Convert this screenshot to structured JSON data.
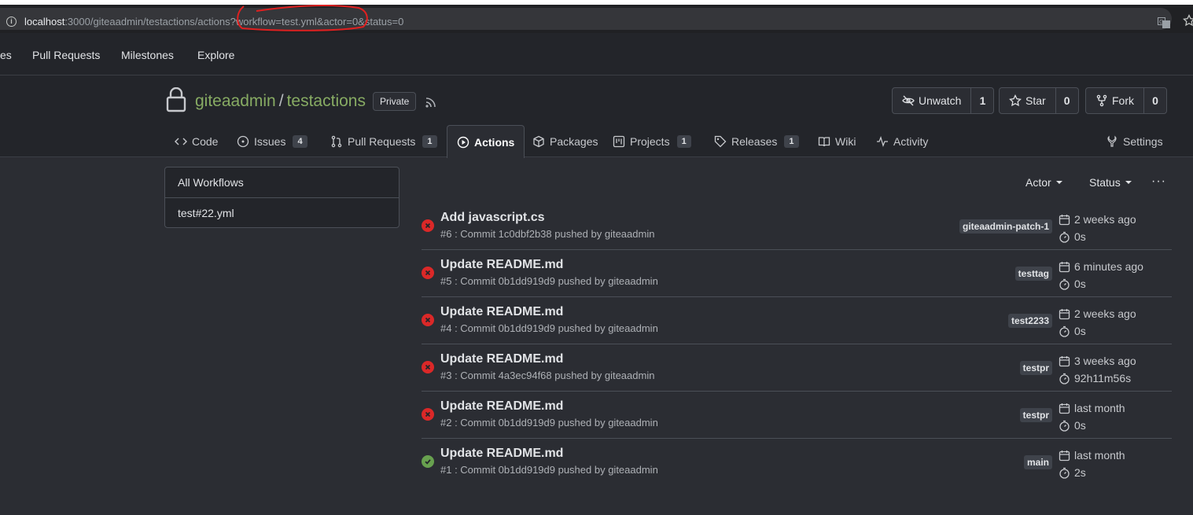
{
  "browser": {
    "url_host": "localhost",
    "url_rest": ":3000/giteaadmin/testactions/actions?workflow=test.yml&actor=0&status=0"
  },
  "topnav": {
    "items": [
      "es",
      "Pull Requests",
      "Milestones",
      "Explore"
    ]
  },
  "repo": {
    "owner": "giteaadmin",
    "separator": "/",
    "name": "testactions",
    "visibility": "Private",
    "unwatch_label": "Unwatch",
    "watch_count": "1",
    "star_label": "Star",
    "star_count": "0",
    "fork_label": "Fork",
    "fork_count": "0"
  },
  "tabs": [
    {
      "label": "Code",
      "icon": "code-icon"
    },
    {
      "label": "Issues",
      "icon": "issue-icon",
      "count": "4"
    },
    {
      "label": "Pull Requests",
      "icon": "pull-request-icon",
      "count": "1"
    },
    {
      "label": "Actions",
      "icon": "play-icon",
      "active": true
    },
    {
      "label": "Packages",
      "icon": "package-icon"
    },
    {
      "label": "Projects",
      "icon": "project-icon",
      "count": "1"
    },
    {
      "label": "Releases",
      "icon": "tag-icon",
      "count": "1"
    },
    {
      "label": "Wiki",
      "icon": "book-icon"
    },
    {
      "label": "Activity",
      "icon": "pulse-icon"
    },
    {
      "label": "Settings",
      "icon": "tool-icon"
    }
  ],
  "sidebar": {
    "items": [
      {
        "label": "All Workflows"
      },
      {
        "label": "test#22.yml"
      }
    ]
  },
  "filters": {
    "actor_label": "Actor",
    "status_label": "Status",
    "more_label": "···"
  },
  "runs": [
    {
      "title": "Add javascript.cs",
      "subtitle": "#6 : Commit 1c0dbf2b38 pushed by giteaadmin",
      "branch": "giteaadmin-patch-1",
      "time": "2 weeks ago",
      "duration": "0s",
      "status": "failure"
    },
    {
      "title": "Update README.md",
      "subtitle": "#5 : Commit 0b1dd919d9 pushed by giteaadmin",
      "branch": "testtag",
      "time": "6 minutes ago",
      "duration": "0s",
      "status": "failure"
    },
    {
      "title": "Update README.md",
      "subtitle": "#4 : Commit 0b1dd919d9 pushed by giteaadmin",
      "branch": "test2233",
      "time": "2 weeks ago",
      "duration": "0s",
      "status": "failure"
    },
    {
      "title": "Update README.md",
      "subtitle": "#3 : Commit 4a3ec94f68 pushed by giteaadmin",
      "branch": "testpr",
      "time": "3 weeks ago",
      "duration": "92h11m56s",
      "status": "failure"
    },
    {
      "title": "Update README.md",
      "subtitle": "#2 : Commit 0b1dd919d9 pushed by giteaadmin",
      "branch": "testpr",
      "time": "last month",
      "duration": "0s",
      "status": "failure"
    },
    {
      "title": "Update README.md",
      "subtitle": "#1 : Commit 0b1dd919d9 pushed by giteaadmin",
      "branch": "main",
      "time": "last month",
      "duration": "2s",
      "status": "success"
    }
  ],
  "colors": {
    "success": "#68a14f",
    "failure": "#db2828",
    "link_green": "#87ab63"
  }
}
